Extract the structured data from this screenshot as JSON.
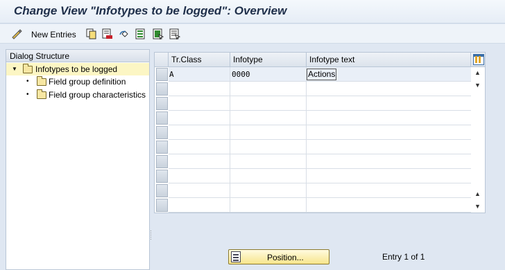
{
  "title": "Change View \"Infotypes to be logged\": Overview",
  "toolbar": {
    "new_entries_label": "New Entries"
  },
  "dialog_structure": {
    "header": "Dialog Structure",
    "items": [
      {
        "label": "Infotypes to be logged",
        "level": 0,
        "selected": true
      },
      {
        "label": "Field group definition",
        "level": 1,
        "selected": false
      },
      {
        "label": "Field group characteristics",
        "level": 1,
        "selected": false
      }
    ]
  },
  "table": {
    "columns": [
      "Tr.Class",
      "Infotype",
      "Infotype text"
    ],
    "rows": [
      {
        "tr_class": "A",
        "infotype": "0000",
        "infotype_text": "Actions"
      }
    ]
  },
  "footer": {
    "position_label": "Position...",
    "entry_info": "Entry 1 of 1"
  },
  "colors": {
    "selected_row": "#fcf6c4",
    "button_accent": "#f7e58c",
    "title_color": "#1f2f4a"
  }
}
